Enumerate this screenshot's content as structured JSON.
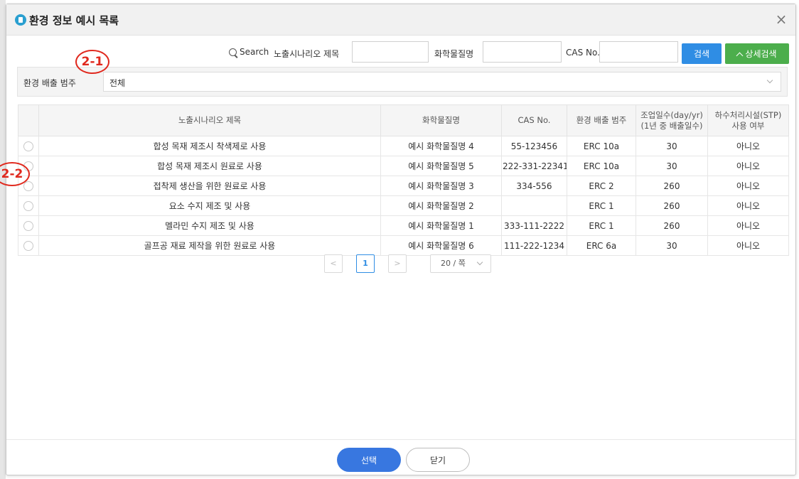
{
  "modal": {
    "title": "환경 정보 예시 목록",
    "close_symbol": "×"
  },
  "search": {
    "label": "Search",
    "scenario_label": "노출시나리오 제목",
    "scenario_value": "",
    "chemical_label": "화학물질명",
    "chemical_value": "",
    "cas_label": "CAS No.",
    "cas_value": "",
    "search_button": "검색",
    "advanced_button": "상세검색"
  },
  "filter": {
    "label": "환경 배출 범주",
    "selected": "전체"
  },
  "annotations": {
    "a1": "2-1",
    "a2": "2-2"
  },
  "table": {
    "headers": {
      "scenario": "노출시나리오 제목",
      "chemical": "화학물질명",
      "cas": "CAS No.",
      "erc": "환경 배출 범주",
      "days_line1": "조업일수(day/yr)",
      "days_line2": "(1년 중 배출일수)",
      "stp_line1": "하수처리시설(STP)",
      "stp_line2": "사용 여부"
    },
    "rows": [
      {
        "scenario": "합성 목재 제조시 착색제로 사용",
        "chemical": "예시 화학물질명 4",
        "cas": "55-123456",
        "erc": "ERC 10a",
        "days": "30",
        "stp": "아니오"
      },
      {
        "scenario": "합성 목재 제조시 원료로 사용",
        "chemical": "예시 화학물질명 5",
        "cas": "222-331-22341",
        "erc": "ERC 10a",
        "days": "30",
        "stp": "아니오"
      },
      {
        "scenario": "접착제 생산을 위한 원료로 사용",
        "chemical": "예시 화학물질명 3",
        "cas": "334-556",
        "erc": "ERC 2",
        "days": "260",
        "stp": "아니오"
      },
      {
        "scenario": "요소 수지 제조 및 사용",
        "chemical": "예시 화학물질명 2",
        "cas": "",
        "erc": "ERC 1",
        "days": "260",
        "stp": "아니오"
      },
      {
        "scenario": "멜라민 수지 제조 및 사용",
        "chemical": "예시 화학물질명 1",
        "cas": "333-111-2222",
        "erc": "ERC 1",
        "days": "260",
        "stp": "아니오"
      },
      {
        "scenario": "골프공 재료 제작을 위한 원료로 사용",
        "chemical": "예시 화학물질명 6",
        "cas": "111-222-1234",
        "erc": "ERC 6a",
        "days": "30",
        "stp": "아니오"
      }
    ]
  },
  "pagination": {
    "prev": "<",
    "current": "1",
    "next": ">",
    "page_size": "20 / 쪽"
  },
  "footer": {
    "select_button": "선택",
    "close_button": "닫기"
  },
  "colors": {
    "primary": "#2f8de4",
    "success": "#4cae4c",
    "annotation": "#e0291e",
    "select_button": "#3877e0"
  }
}
